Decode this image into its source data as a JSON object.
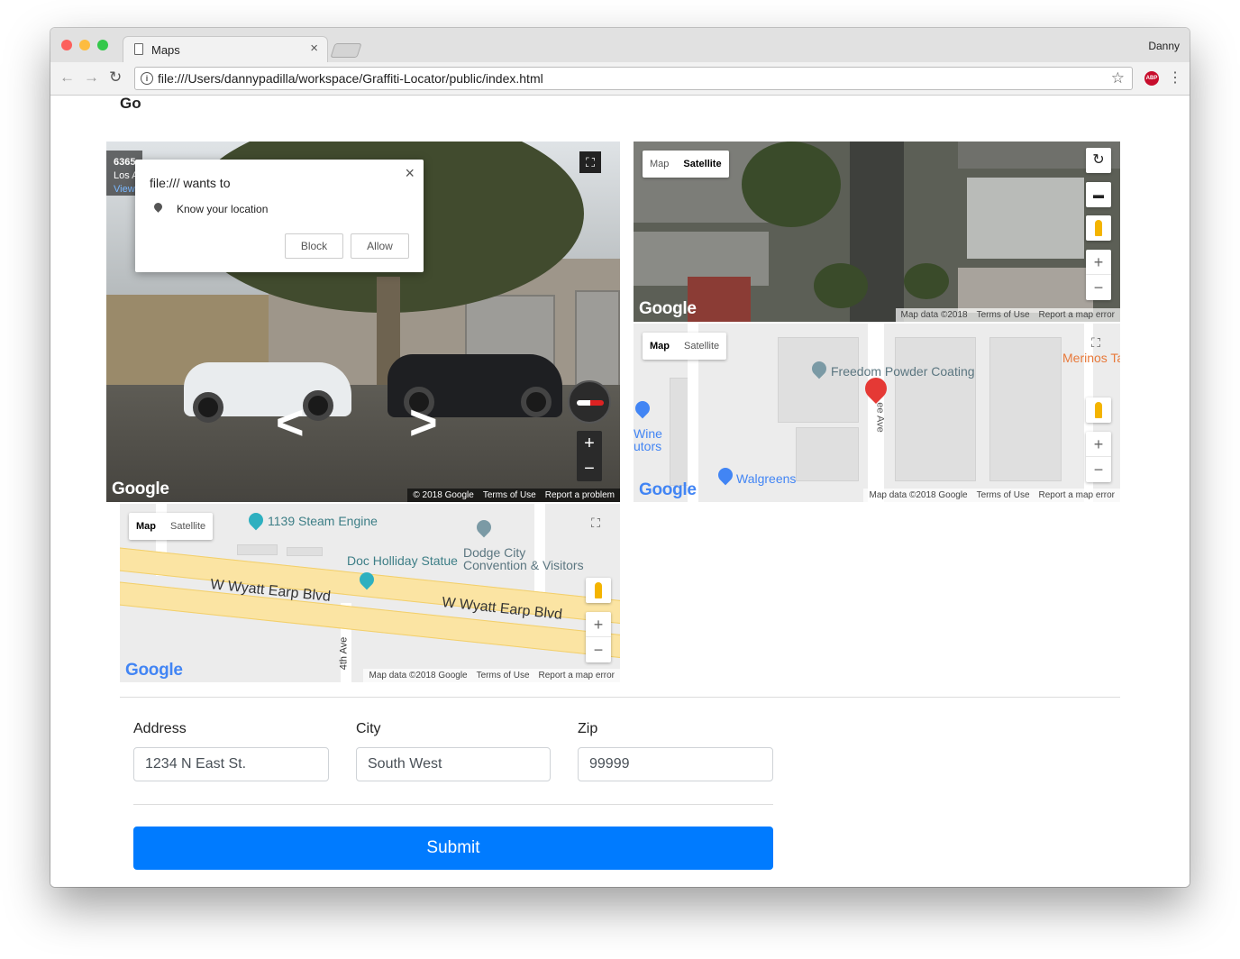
{
  "browser": {
    "tab_title": "Maps",
    "profile_name": "Danny",
    "url": "file:///Users/dannypadilla/workspace/Graffiti-Locator/public/index.html",
    "abp_label": "ABP"
  },
  "page": {
    "title_partial": "Go"
  },
  "permission_popup": {
    "title": "file:/// wants to",
    "request": "Know your location",
    "block_label": "Block",
    "allow_label": "Allow"
  },
  "streetview": {
    "address_line1": "6365",
    "address_line2": "Los A",
    "address_line3": "View",
    "google_logo": "Google",
    "attribution": {
      "copyright": "© 2018 Google",
      "terms": "Terms of Use",
      "report": "Report a problem"
    }
  },
  "satellite_map": {
    "map_label": "Map",
    "satellite_label": "Satellite",
    "active": "Satellite",
    "google_logo": "Google",
    "attribution": {
      "data": "Map data ©2018",
      "terms": "Terms of Use",
      "report": "Report a map error"
    }
  },
  "roadmap_right": {
    "map_label": "Map",
    "satellite_label": "Satellite",
    "active": "Map",
    "pois": [
      "Freedom Powder Coating",
      "Merinos Ta",
      "Wine",
      "utors",
      "Walgreens"
    ],
    "street": "ee Ave",
    "google_logo": "Google",
    "attribution": {
      "data": "Map data ©2018 Google",
      "terms": "Terms of Use",
      "report": "Report a map error"
    }
  },
  "roadmap_bottom": {
    "map_label": "Map",
    "satellite_label": "Satellite",
    "active": "Map",
    "pois": [
      "1139 Steam Engine",
      "Doc Holliday Statue",
      "Dodge City",
      "Convention & Visitors"
    ],
    "roads": [
      "W Wyatt Earp Blvd",
      "W Wyatt Earp Blvd",
      "4th Ave"
    ],
    "google_logo": "Google",
    "attribution": {
      "data": "Map data ©2018 Google",
      "terms": "Terms of Use",
      "report": "Report a map error"
    }
  },
  "form": {
    "address_label": "Address",
    "address_value": "1234 N East St.",
    "city_label": "City",
    "city_value": "South West",
    "zip_label": "Zip",
    "zip_value": "99999",
    "submit_label": "Submit"
  },
  "colors": {
    "submit_bg": "#007bff",
    "map_pin": "#e53935",
    "poi_teal": "#2eb0c0",
    "poi_orange": "#e8793a"
  }
}
